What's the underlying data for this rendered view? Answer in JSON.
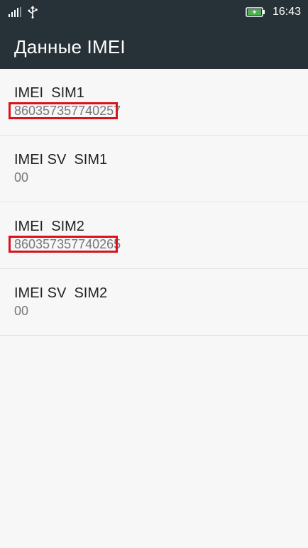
{
  "status_bar": {
    "time": "16:43",
    "icons_left": [
      "signal-icon",
      "usb-icon"
    ],
    "icons_right": [
      "battery-charging-icon"
    ]
  },
  "app_bar": {
    "title": "Данные IMEI"
  },
  "items": [
    {
      "title": "IMEI  SIM1",
      "value": "860357357740257",
      "highlighted": true
    },
    {
      "title": "IMEI SV  SIM1",
      "value": "00",
      "highlighted": false
    },
    {
      "title": "IMEI  SIM2",
      "value": "860357357740265",
      "highlighted": true
    },
    {
      "title": "IMEI SV  SIM2",
      "value": "00",
      "highlighted": false
    }
  ],
  "colors": {
    "top_bar": "#263238",
    "highlight": "#d8141b",
    "background": "#f7f7f7",
    "title_text": "#222222",
    "value_text": "#777777"
  }
}
